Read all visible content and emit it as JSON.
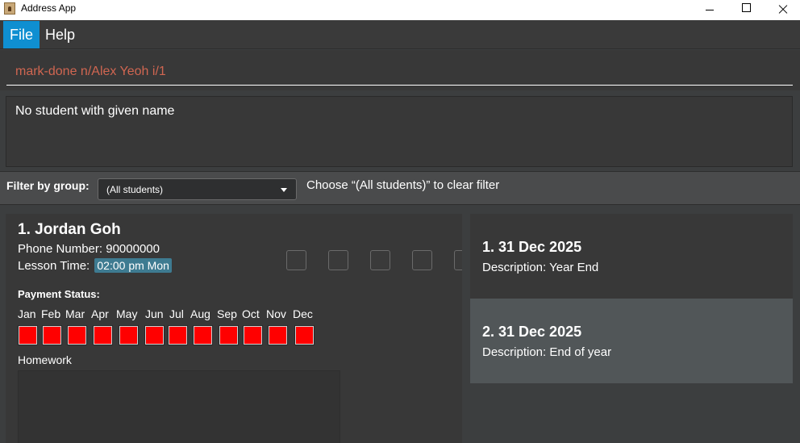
{
  "window": {
    "title": "Address App"
  },
  "menu": {
    "file": "File",
    "help": "Help"
  },
  "command": {
    "value": "mark-done n/Alex Yeoh i/1"
  },
  "result": {
    "text": "No student with given name"
  },
  "filter": {
    "label": "Filter by group:",
    "selected": "(All students)",
    "hint": "Choose “(All students)” to clear filter"
  },
  "student": {
    "name": "1. Jordan Goh",
    "phone": "Phone Number: 90000000",
    "lesson_label": "Lesson Time:",
    "lesson_time": "02:00 pm Mon",
    "payment_label": "Payment Status:",
    "months": [
      "Jan",
      "Feb",
      "Mar",
      "Apr",
      "May",
      "Jun",
      "Jul",
      "Aug",
      "Sep",
      "Oct",
      "Nov",
      "Dec"
    ],
    "paid": [
      false,
      false,
      false,
      false,
      false,
      false,
      false,
      false,
      false,
      false,
      false,
      false
    ],
    "unpaid_color": "#ff0000",
    "homework_label": "Homework"
  },
  "events": [
    {
      "title": "1. 31 Dec 2025",
      "description": "Description: Year End"
    },
    {
      "title": "2. 31 Dec 2025",
      "description": "Description: End of year"
    }
  ]
}
